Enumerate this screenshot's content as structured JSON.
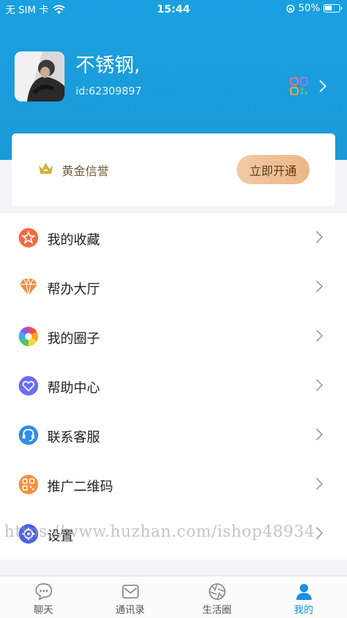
{
  "status_bar": {
    "carrier": "无 SIM 卡",
    "time": "15:44",
    "battery": "50%",
    "battery_level": 0.5
  },
  "profile": {
    "name": "不锈钢,",
    "id": "id:62309897"
  },
  "vip": {
    "label": "黄金信誉",
    "button": "立即开通"
  },
  "menu": {
    "items": [
      {
        "label": "我的收藏",
        "icon": "star-bag-icon"
      },
      {
        "label": "帮办大厅",
        "icon": "diamond-icon"
      },
      {
        "label": "我的圈子",
        "icon": "camera-aperture-icon"
      },
      {
        "label": "帮助中心",
        "icon": "heart-icon"
      },
      {
        "label": "联系客服",
        "icon": "headset-icon"
      },
      {
        "label": "推广二维码",
        "icon": "qr-code-icon"
      },
      {
        "label": "设置",
        "icon": "gear-icon"
      }
    ]
  },
  "watermark": "https://www.huzhan.com/ishop48934",
  "tabbar": {
    "tabs": [
      {
        "label": "聊天",
        "icon": "chat-bubble-icon"
      },
      {
        "label": "通讯录",
        "icon": "mail-icon"
      },
      {
        "label": "生活圈",
        "icon": "aperture-icon"
      },
      {
        "label": "我的",
        "icon": "user-icon"
      }
    ],
    "active_index": 3
  },
  "colors": {
    "header": "#1b9ad9",
    "accent": "#1a8fe0",
    "vip_button": "#ecb787"
  }
}
